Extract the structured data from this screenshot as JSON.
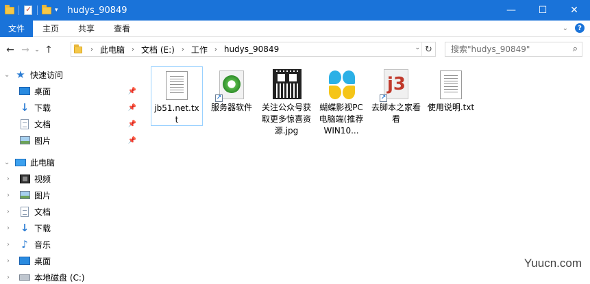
{
  "window": {
    "title": "hudys_90849",
    "minimize": "—",
    "maximize": "☐",
    "close": "✕"
  },
  "ribbon": {
    "tabs": [
      {
        "label": "文件"
      },
      {
        "label": "主页"
      },
      {
        "label": "共享"
      },
      {
        "label": "查看"
      }
    ]
  },
  "address": {
    "crumbs": [
      "此电脑",
      "文档 (E:)",
      "工作",
      "hudys_90849"
    ]
  },
  "search": {
    "placeholder": "搜索\"hudys_90849\""
  },
  "nav": {
    "quick_access": "快速访问",
    "quick_items": [
      {
        "label": "桌面",
        "icon": "desktop-icon"
      },
      {
        "label": "下载",
        "icon": "download-icon"
      },
      {
        "label": "文档",
        "icon": "document-icon"
      },
      {
        "label": "图片",
        "icon": "picture-icon"
      }
    ],
    "this_pc": "此电脑",
    "pc_items": [
      {
        "label": "视频",
        "icon": "video-icon"
      },
      {
        "label": "图片",
        "icon": "picture-icon"
      },
      {
        "label": "文档",
        "icon": "document-icon"
      },
      {
        "label": "下载",
        "icon": "download-icon"
      },
      {
        "label": "音乐",
        "icon": "music-icon"
      },
      {
        "label": "桌面",
        "icon": "desktop-icon"
      },
      {
        "label": "本地磁盘 (C:)",
        "icon": "disk-icon"
      }
    ]
  },
  "files": [
    {
      "name": "jb51.net.txt",
      "icon": "text-file-icon",
      "selected": true
    },
    {
      "name": "服务器软件",
      "icon": "ie-shortcut-icon",
      "selected": false
    },
    {
      "name": "关注公众号获取更多惊喜资源.jpg",
      "icon": "qr-image-icon",
      "selected": false
    },
    {
      "name": "蝴蝶影视PC电脑端(推荐WIN10...",
      "icon": "butterfly-app-icon",
      "selected": false
    },
    {
      "name": "去脚本之家看看",
      "icon": "jb-shortcut-icon",
      "selected": false
    },
    {
      "name": "使用说明.txt",
      "icon": "text-file-icon",
      "selected": false
    }
  ],
  "watermark": "Yuucn.com",
  "colors": {
    "accent": "#1a73d9",
    "selection_border": "#99d1ff"
  }
}
